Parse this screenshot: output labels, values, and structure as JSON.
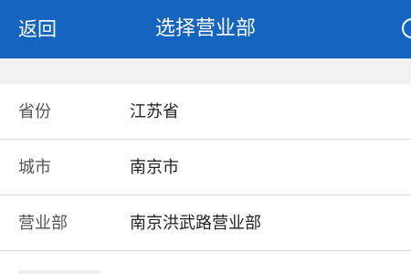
{
  "header": {
    "back_label": "返回",
    "title": "选择营业部"
  },
  "form": {
    "rows": [
      {
        "label": "省份",
        "value": "江苏省"
      },
      {
        "label": "城市",
        "value": "南京市"
      },
      {
        "label": "营业部",
        "value": "南京洪武路营业部"
      }
    ]
  },
  "colors": {
    "header_bg": "#1565c0",
    "gap_bg": "#f2f2f2",
    "divider": "#dcdcdc"
  }
}
